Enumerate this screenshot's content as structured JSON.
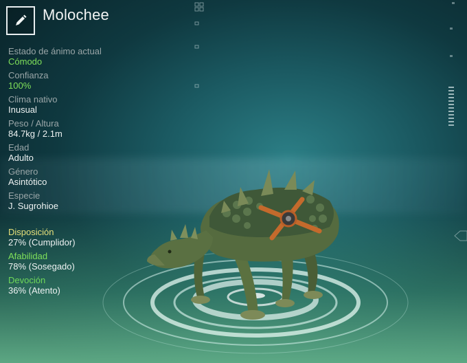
{
  "header": {
    "name": "Molochee",
    "edit_icon": "pencil-icon"
  },
  "stats": [
    {
      "label": "Estado de ánimo actual",
      "value": "Cómodo",
      "highlight": true
    },
    {
      "label": "Confianza",
      "value": "100%",
      "highlight": true
    },
    {
      "label": "Clima nativo",
      "value": "Inusual",
      "highlight": false
    },
    {
      "label": "Peso / Altura",
      "value": "84.7kg / 2.1m",
      "highlight": false
    },
    {
      "label": "Edad",
      "value": "Adulto",
      "highlight": false
    },
    {
      "label": "Género",
      "value": "Asintótico",
      "highlight": false
    },
    {
      "label": "Especie",
      "value": "J. Sugrohioe",
      "highlight": false
    }
  ],
  "traits": [
    {
      "label": "Disposición",
      "value": "27% (Cumplidor)",
      "color": "#e6e07a"
    },
    {
      "label": "Afabilidad",
      "value": "78% (Sosegado)",
      "color": "#7fe05a"
    },
    {
      "label": "Devoción",
      "value": "36% (Atento)",
      "color": "#6fd85a"
    }
  ],
  "colors": {
    "green_value": "#7fe05a",
    "label_grey": "#9aa6a8"
  }
}
